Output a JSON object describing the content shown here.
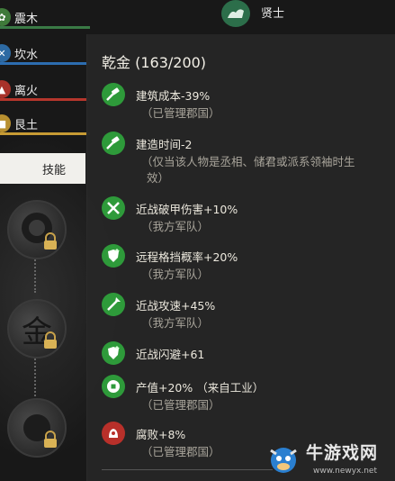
{
  "attributes": [
    {
      "label": "震木",
      "icon": "wood-icon",
      "color": "#3f7a3a",
      "bar_color": "#3a7a46"
    },
    {
      "label": "坎水",
      "icon": "water-icon",
      "color": "#2d6aa3",
      "bar_color": "#2c6db0"
    },
    {
      "label": "离火",
      "icon": "fire-icon",
      "color": "#a8322a",
      "bar_color": "#b5362c"
    },
    {
      "label": "艮土",
      "icon": "earth-icon",
      "color": "#b89030",
      "bar_color": "#c79b34"
    }
  ],
  "skill_tab": {
    "label": "技能"
  },
  "skill_glyph": "金",
  "top_right": {
    "label": "贤士",
    "icon": "sage-icon"
  },
  "tooltip": {
    "title": "乾金 (163/200)",
    "effects": [
      {
        "icon": "hammer-plus-icon",
        "icon_color": "#2e9a3a",
        "text": "建筑成本-39%",
        "sub": "（已管理郡国）",
        "sub2": ""
      },
      {
        "icon": "hammer-time-icon",
        "icon_color": "#2e9a3a",
        "text": "建造时间-2",
        "sub": "（仅当该人物是丞相、储君或派系领袖时生",
        "sub2": "效）"
      },
      {
        "icon": "crossed-swords-icon",
        "icon_color": "#2e9a3a",
        "text": "近战破甲伤害+10%",
        "sub": "（我方军队）",
        "sub2": ""
      },
      {
        "icon": "shield-up-icon",
        "icon_color": "#2e9a3a",
        "text": "远程格挡概率+20%",
        "sub": "（我方军队）",
        "sub2": ""
      },
      {
        "icon": "swords-up-icon",
        "icon_color": "#2e9a3a",
        "text": "近战攻速+45%",
        "sub": "（我方军队）",
        "sub2": ""
      },
      {
        "icon": "dodge-up-icon",
        "icon_color": "#2e9a3a",
        "text": "近战闪避+61",
        "sub": "",
        "sub2": ""
      },
      {
        "icon": "coin-icon",
        "icon_color": "#2e9a3a",
        "text": "产值+20% （来自工业）",
        "sub": "（已管理郡国）",
        "sub2": ""
      },
      {
        "icon": "corruption-icon",
        "icon_color": "#b8302a",
        "text": "腐败+8%",
        "sub": "（已管理郡国）",
        "sub2": ""
      }
    ]
  },
  "watermark": {
    "title": "牛游戏网",
    "url": "www.newyx.net"
  }
}
